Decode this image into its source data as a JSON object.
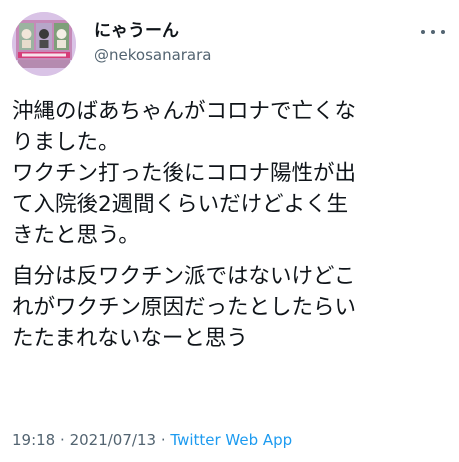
{
  "author": {
    "display_name": "にゃうーん",
    "handle": "@nekosanarara",
    "avatar_icon": "cat-collage-avatar-icon",
    "avatar_colors": {
      "frame": "#c58ab8",
      "panel_left": "#9bb3a0",
      "panel_mid": "#b7a6c9",
      "panel_right": "#7f9f7a",
      "strip": "#d63d7a"
    }
  },
  "more_icon": "more-options-icon",
  "tweet": {
    "lines": [
      "沖縄のばあちゃんがコロナで亡くな",
      "りました。",
      "ワクチン打った後にコロナ陽性が出",
      "て入院後2週間くらいだけどよく生",
      "きたと思う。",
      "自分は反ワクチン派ではないけどこ",
      "れがワクチン原因だったとしたらい",
      "たたまれないなーと思う"
    ]
  },
  "meta": {
    "time": "19:18",
    "separator": "·",
    "date": "2021/07/13",
    "separator2": "·",
    "source": "Twitter Web App"
  },
  "colors": {
    "text": "#0f1419",
    "secondary": "#536471",
    "link": "#1d9bf0"
  }
}
